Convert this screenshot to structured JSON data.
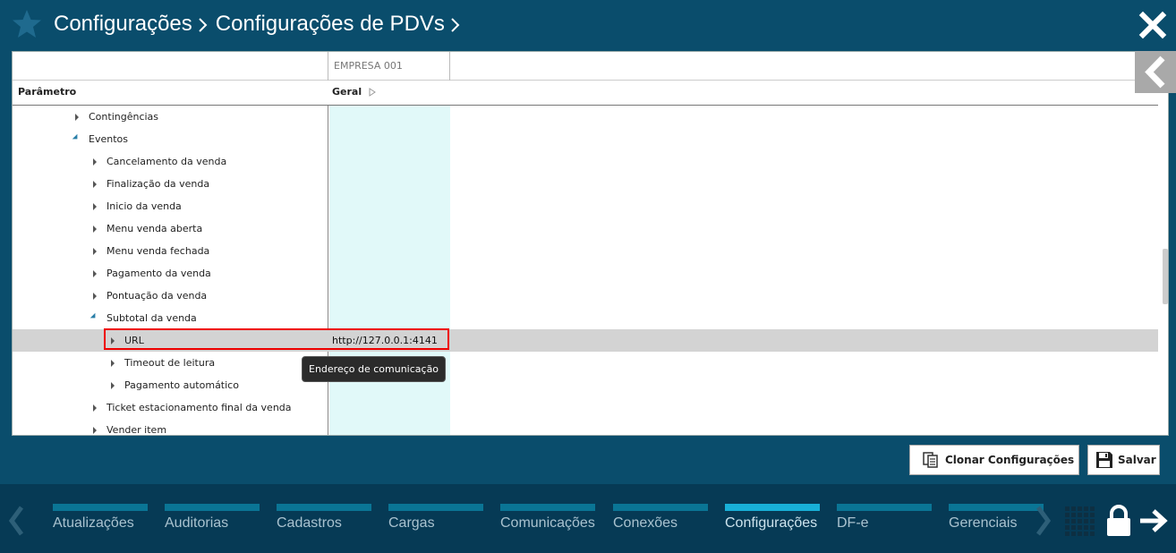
{
  "breadcrumb": [
    "Configurações",
    "Configurações de PDVs"
  ],
  "columns": {
    "empresa": "EMPRESA 001",
    "parametro": "Parâmetro",
    "geral": "Geral"
  },
  "tree": [
    {
      "label": "Contingências",
      "expanded": false
    },
    {
      "label": "Eventos",
      "expanded": true
    },
    {
      "label": "Cancelamento da venda",
      "expanded": false
    },
    {
      "label": "Finalização da venda",
      "expanded": false
    },
    {
      "label": "Inicio da venda",
      "expanded": false
    },
    {
      "label": "Menu venda aberta",
      "expanded": false
    },
    {
      "label": "Menu venda fechada",
      "expanded": false
    },
    {
      "label": "Pagamento da venda",
      "expanded": false
    },
    {
      "label": "Pontuação da venda",
      "expanded": false
    },
    {
      "label": "Subtotal da venda",
      "expanded": true
    },
    {
      "label": "URL",
      "expanded": false,
      "value": "http://127.0.0.1:4141",
      "selected": true
    },
    {
      "label": "Timeout de leitura",
      "expanded": false
    },
    {
      "label": "Pagamento automático",
      "expanded": false
    },
    {
      "label": "Ticket estacionamento final da venda",
      "expanded": false
    },
    {
      "label": "Vender item",
      "expanded": false
    }
  ],
  "tooltip": "Endereço de comunicação",
  "actions": {
    "clone": "Clonar Configurações",
    "save": "Salvar"
  },
  "nav": {
    "items": [
      "Atualizações",
      "Auditorias",
      "Cadastros",
      "Cargas",
      "Comunicações",
      "Conexões",
      "Configurações",
      "DF-e",
      "Gerenciais"
    ],
    "active": "Configurações"
  },
  "colors": {
    "background": "#0a4d6c",
    "nav_bar": "#0a7595",
    "nav_active": "#18b0d8",
    "highlight": "#e00000",
    "value_column": "#e1f9f9"
  }
}
